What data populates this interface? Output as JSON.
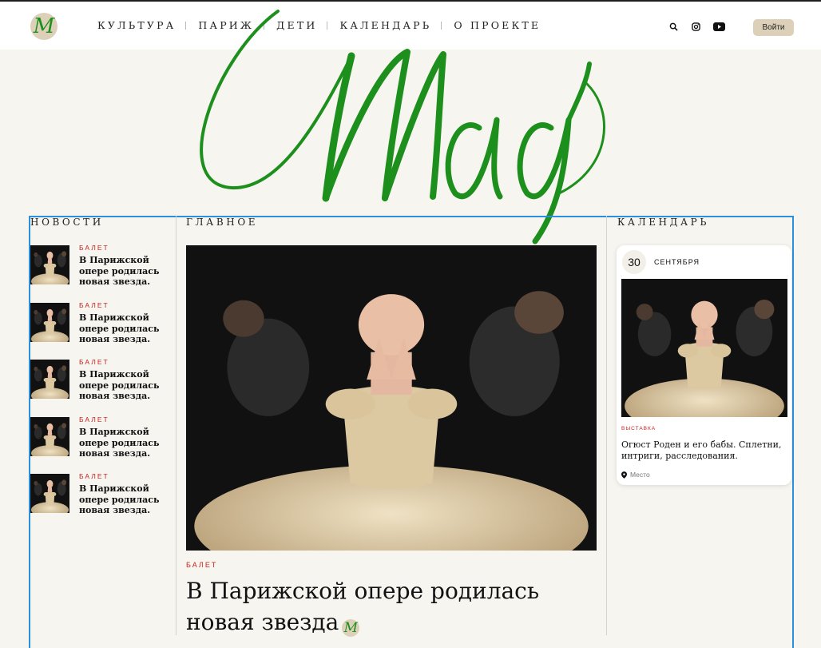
{
  "header": {
    "logo_letter": "M",
    "nav": [
      "КУЛЬТУРА",
      "ПАРИЖ",
      "ДЕТИ",
      "КАЛЕНДАРЬ",
      "О ПРОЕКТЕ"
    ],
    "login_label": "Войти",
    "icons": [
      "search-icon",
      "instagram-icon",
      "youtube-icon"
    ]
  },
  "masthead": {
    "text": "Maag"
  },
  "news": {
    "title": "НОВОСТИ",
    "items": [
      {
        "tag": "БАЛЕТ",
        "title": "В Парижской опере родилась новая звезда."
      },
      {
        "tag": "БАЛЕТ",
        "title": "В Парижской опере родилась новая звезда."
      },
      {
        "tag": "БАЛЕТ",
        "title": "В Парижской опере родилась новая звезда."
      },
      {
        "tag": "БАЛЕТ",
        "title": "В Парижской опере родилась новая звезда."
      },
      {
        "tag": "БАЛЕТ",
        "title": "В Парижской опере родилась новая звезда."
      }
    ]
  },
  "main": {
    "title": "ГЛАВНОЕ",
    "tag": "БАЛЕТ",
    "headline": "В Парижской опере родилась новая звезда"
  },
  "calendar": {
    "title": "КАЛЕНДАРЬ",
    "day": "30",
    "month": "СЕНТЯБРЯ",
    "tag": "ВЫСТАВКА",
    "event_title": "Огюст Роден и его бабы. Сплетни, интриги, расследования.",
    "place": "Место"
  },
  "colors": {
    "brand_green": "#1d8f1d",
    "accent_red": "#c4241f",
    "beige": "#dcd0b8",
    "background": "#f7f5f0",
    "frame_blue": "#2b8fe0"
  }
}
